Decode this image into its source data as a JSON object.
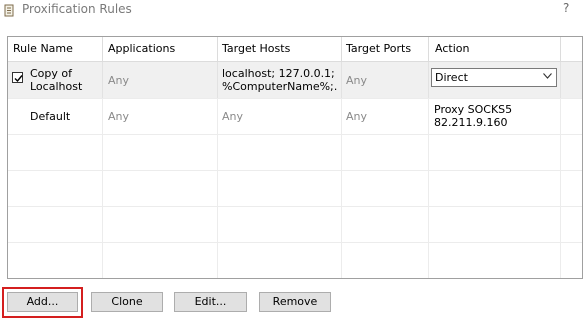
{
  "window": {
    "title": "Proxification Rules",
    "help": "?"
  },
  "table": {
    "columns": [
      "Rule Name",
      "Applications",
      "Target Hosts",
      "Target Ports",
      "Action"
    ],
    "rows": [
      {
        "checked": true,
        "name": "Copy of\nLocalhost",
        "applications": "Any",
        "target_hosts": "localhost; 127.0.0.1;\n%ComputerName%;…",
        "target_ports": "Any",
        "action": "Direct"
      },
      {
        "name": "Default",
        "applications": "Any",
        "target_hosts": "Any",
        "target_ports": "Any",
        "action": "Proxy SOCKS5\n82.211.9.160"
      }
    ]
  },
  "buttons": {
    "add": "Add...",
    "clone": "Clone",
    "edit": "Edit...",
    "remove": "Remove"
  },
  "icons": {
    "title": "scroll-icon",
    "check": "checkmark-icon",
    "dropdown": "chevron-down-icon"
  },
  "colors": {
    "focus_highlight": "#d41f1f",
    "selected_row": "#f0f0f0"
  }
}
